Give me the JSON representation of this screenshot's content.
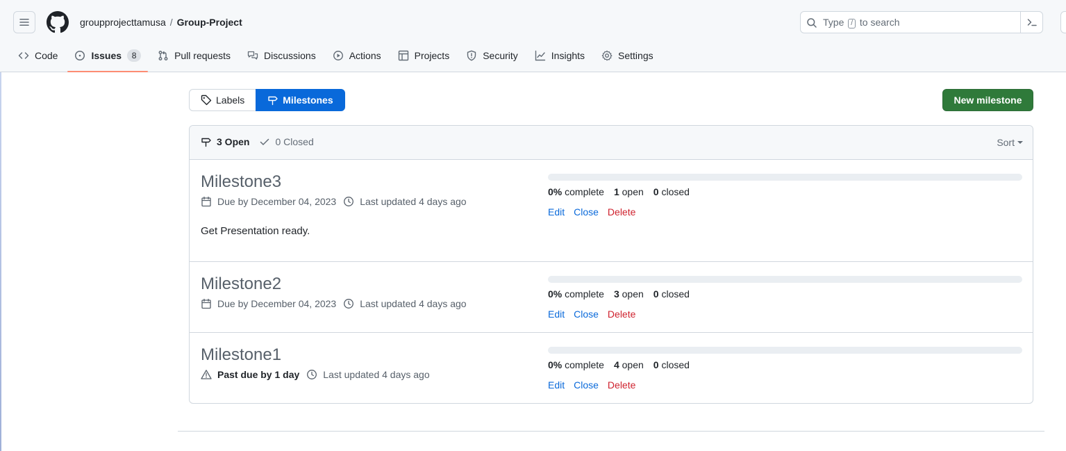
{
  "header": {
    "owner": "groupprojecttamusa",
    "separator": "/",
    "repo": "Group-Project",
    "search": {
      "before_key": "Type",
      "key": "/",
      "after_key": "to search"
    }
  },
  "tabs": [
    {
      "label": "Code",
      "icon": "code-icon"
    },
    {
      "label": "Issues",
      "icon": "issue-opened-icon",
      "count": "8",
      "active": true
    },
    {
      "label": "Pull requests",
      "icon": "git-pull-request-icon"
    },
    {
      "label": "Discussions",
      "icon": "comment-discussion-icon"
    },
    {
      "label": "Actions",
      "icon": "play-icon"
    },
    {
      "label": "Projects",
      "icon": "table-icon"
    },
    {
      "label": "Security",
      "icon": "shield-icon"
    },
    {
      "label": "Insights",
      "icon": "graph-icon"
    },
    {
      "label": "Settings",
      "icon": "gear-icon"
    }
  ],
  "subnav": {
    "labels": "Labels",
    "milestones": "Milestones"
  },
  "new_milestone_label": "New milestone",
  "states": {
    "open": "3 Open",
    "closed": "0 Closed"
  },
  "sort_label": "Sort",
  "milestones": [
    {
      "title": "Milestone3",
      "due": "Due by December 04, 2023",
      "updated": "Last updated 4 days ago",
      "description": "Get Presentation ready.",
      "percent": "0%",
      "complete_label": "complete",
      "open_count": "1",
      "open_label": "open",
      "closed_count": "0",
      "closed_label": "closed",
      "progress": 0
    },
    {
      "title": "Milestone2",
      "due": "Due by December 04, 2023",
      "updated": "Last updated 4 days ago",
      "percent": "0%",
      "complete_label": "complete",
      "open_count": "3",
      "open_label": "open",
      "closed_count": "0",
      "closed_label": "closed",
      "progress": 0
    },
    {
      "title": "Milestone1",
      "pastdue": "Past due by 1 day",
      "updated": "Last updated 4 days ago",
      "percent": "0%",
      "complete_label": "complete",
      "open_count": "4",
      "open_label": "open",
      "closed_count": "0",
      "closed_label": "closed",
      "progress": 0
    }
  ],
  "actions": {
    "edit": "Edit",
    "close": "Close",
    "delete": "Delete"
  },
  "colors": {
    "accent": "#0969da",
    "primary_button": "#2f7a3a",
    "danger": "#cf222e",
    "tab_underline": "#fd8c73"
  }
}
